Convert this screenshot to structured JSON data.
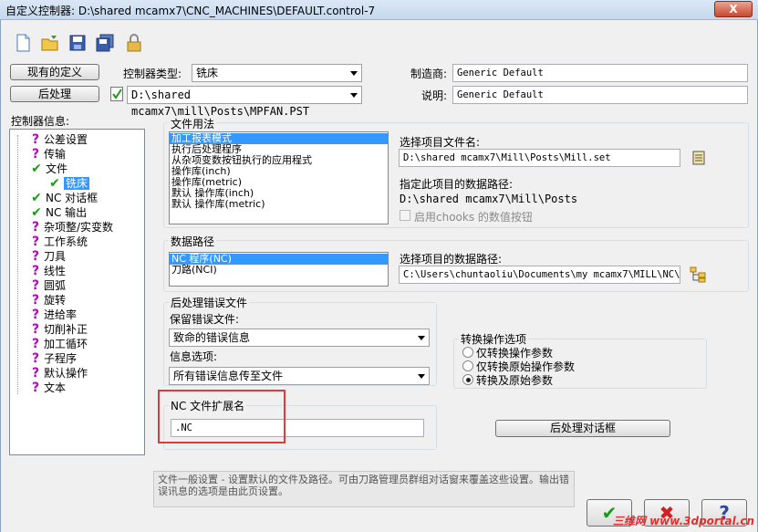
{
  "window": {
    "title": "自定义控制器: D:\\shared mcamx7\\CNC_MACHINES\\DEFAULT.control-7",
    "close_label": "X"
  },
  "toolbar": {
    "icons": [
      "new-file-icon",
      "open-folder-icon",
      "save-icon",
      "save-all-icon",
      "lock-icon"
    ]
  },
  "header": {
    "existing_def_label": "现有的定义",
    "post_label": "后处理",
    "controller_type_label": "控制器类型:",
    "controller_type_value": "铣床",
    "post_path": "D:\\shared mcamx7\\mill\\Posts\\MPFAN.PST",
    "manufacturer_label": "制造商:",
    "manufacturer_value": "Generic Default",
    "description_label": "说明:",
    "description_value": "Generic Default"
  },
  "tree": {
    "title": "控制器信息:",
    "items": [
      {
        "label": "公差设置",
        "status": "question"
      },
      {
        "label": "传输",
        "status": "question"
      },
      {
        "label": "文件",
        "status": "check"
      },
      {
        "label": "铣床",
        "status": "check",
        "selected": true
      },
      {
        "label": "NC 对话框",
        "status": "check"
      },
      {
        "label": "NC 输出",
        "status": "check"
      },
      {
        "label": "杂项整/实变数",
        "status": "question"
      },
      {
        "label": "工作系统",
        "status": "question"
      },
      {
        "label": "刀具",
        "status": "question"
      },
      {
        "label": "线性",
        "status": "question"
      },
      {
        "label": "圆弧",
        "status": "question"
      },
      {
        "label": "旋转",
        "status": "question"
      },
      {
        "label": "进给率",
        "status": "question"
      },
      {
        "label": "切削补正",
        "status": "question"
      },
      {
        "label": "加工循环",
        "status": "question"
      },
      {
        "label": "子程序",
        "status": "question"
      },
      {
        "label": "默认操作",
        "status": "question"
      },
      {
        "label": "文本",
        "status": "question"
      }
    ]
  },
  "file_usage": {
    "title": "文件用法",
    "items": [
      "加工报表模式",
      "执行后处理程序",
      "从杂项变数按钮执行的应用程式",
      "操作库(inch)",
      "操作库(metric)",
      "默认 操作库(inch)",
      "默认 操作库(metric)"
    ],
    "select_label": "选择项目文件名:",
    "select_value": "D:\\shared mcamx7\\Mill\\Posts\\Mill.set",
    "path_label": "指定此项目的数据路径:",
    "path_value": "D:\\shared mcamx7\\Mill\\Posts",
    "chooks_label": "启用chooks 的数值按钮"
  },
  "data_path": {
    "title": "数据路径",
    "items": [
      "NC 程序(NC)",
      "刀路(NCI)"
    ],
    "select_label": "选择项目的数据路径:",
    "select_value": "C:\\Users\\chuntaoliu\\Documents\\my mcamx7\\MILL\\NC\\"
  },
  "post_error": {
    "title": "后处理错误文件",
    "keep_label": "保留错误文件:",
    "keep_value": "致命的错误信息",
    "info_label": "信息选项:",
    "info_value": "所有错误信息传至文件"
  },
  "convert": {
    "title": "转换操作选项",
    "options": [
      "仅转换操作参数",
      "仅转换原始操作参数",
      "转换及原始参数"
    ],
    "selected_index": 2
  },
  "nc_ext": {
    "title": "NC 文件扩展名",
    "value": ".NC"
  },
  "post_dialog_button": "后处理对话框",
  "footer": {
    "description": "文件一般设置 - 设置默认的文件及路径。可由刀路管理员群组对话窗来覆盖这些设置。输出错误讯息的选项是由此页设置。",
    "ok_label": "✔",
    "cancel_label": "✖",
    "help_label": "?",
    "watermark": "三维网 www.3dportal.cn"
  }
}
